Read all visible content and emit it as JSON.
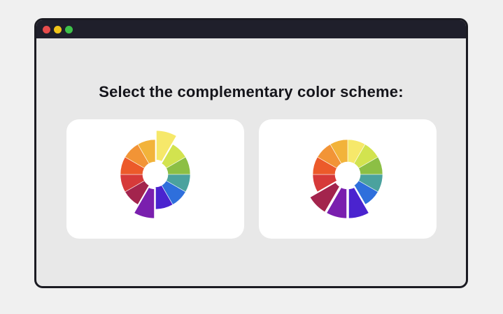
{
  "page": {
    "prompt": "Select the complementary color scheme:"
  },
  "wheel_colors": [
    "#f6e86a",
    "#d2e34f",
    "#8cbf45",
    "#4ba29e",
    "#2e6fdc",
    "#4a23cf",
    "#7a1fae",
    "#a3244d",
    "#d63a3a",
    "#ec5a2a",
    "#f29436",
    "#f2b33a"
  ],
  "options": [
    {
      "id": "option-a",
      "highlighted_segments": [
        0,
        6
      ]
    },
    {
      "id": "option-b",
      "highlighted_segments": [
        5,
        6,
        7
      ]
    }
  ]
}
